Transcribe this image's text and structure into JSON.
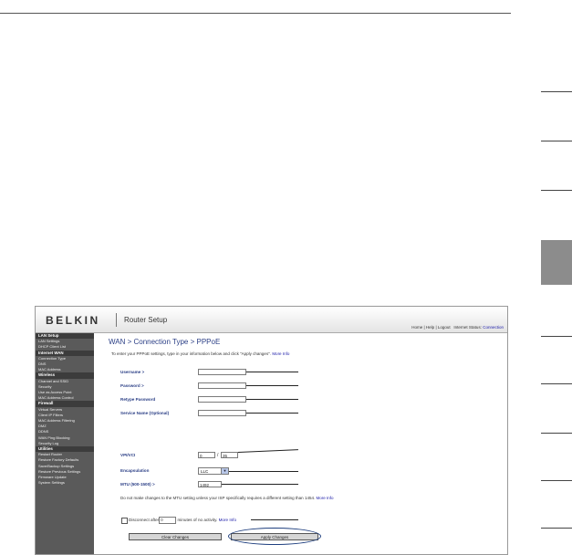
{
  "header": {
    "logo": "BELKIN",
    "product": "Router Setup",
    "links": {
      "home": "Home",
      "sep1": "|",
      "help": "Help",
      "sep2": "|",
      "logout": "Logout",
      "status_label": "Internet Status:",
      "status_value": "Connection"
    }
  },
  "sidebar": {
    "sections": [
      {
        "heading": "LAN Setup",
        "items": [
          "LAN Settings",
          "DHCP Client List"
        ]
      },
      {
        "heading": "Internet WAN",
        "items": [
          "Connection Type",
          "DNS",
          "MAC Address"
        ]
      },
      {
        "heading": "Wireless",
        "items": [
          "Channel and SSID",
          "Security",
          "Use as Access Point",
          "MAC Address Control"
        ]
      },
      {
        "heading": "Firewall",
        "items": [
          "Virtual Servers",
          "Client IP Filters",
          "MAC Address Filtering",
          "DMZ",
          "DDNS",
          "WAN Ping Blocking",
          "Security Log"
        ]
      },
      {
        "heading": "Utilities",
        "items": [
          "Restart Router",
          "Restore Factory Defaults",
          "Save/Backup Settings",
          "Restore Previous Settings",
          "Firmware Update",
          "System Settings"
        ]
      }
    ]
  },
  "page": {
    "title": "WAN > Connection Type > PPPoE",
    "intro": "To enter your PPPoE settings, type in your information below and click \"Apply changes\".",
    "more_info": "More Info"
  },
  "form": {
    "username_label": "Username >",
    "username_value": "",
    "password_label": "Password >",
    "password_value": "",
    "retype_label": "Retype Password",
    "retype_value": "",
    "service_label": "Service Name (Optional)",
    "service_value": "",
    "vpivci_label": "VPI/VCI",
    "vpi_value": "0",
    "vci_sep": "/",
    "vci_value": "35",
    "encap_label": "Encapsulation",
    "encap_value": "LLC",
    "mtu_label": "MTU (500-1500) >",
    "mtu_value": "1492",
    "note": "Do not make changes to the MTU setting unless your ISP specifically requires a different setting than 1454.",
    "note_link": "More Info",
    "disconnect_pre": "Disconnect after",
    "disconnect_minutes": "0",
    "disconnect_post": "minutes of no activity.",
    "disconnect_link": "More Info",
    "disconnect_checked": false
  },
  "buttons": {
    "clear": "Clear Changes",
    "apply": "Apply Changes"
  }
}
